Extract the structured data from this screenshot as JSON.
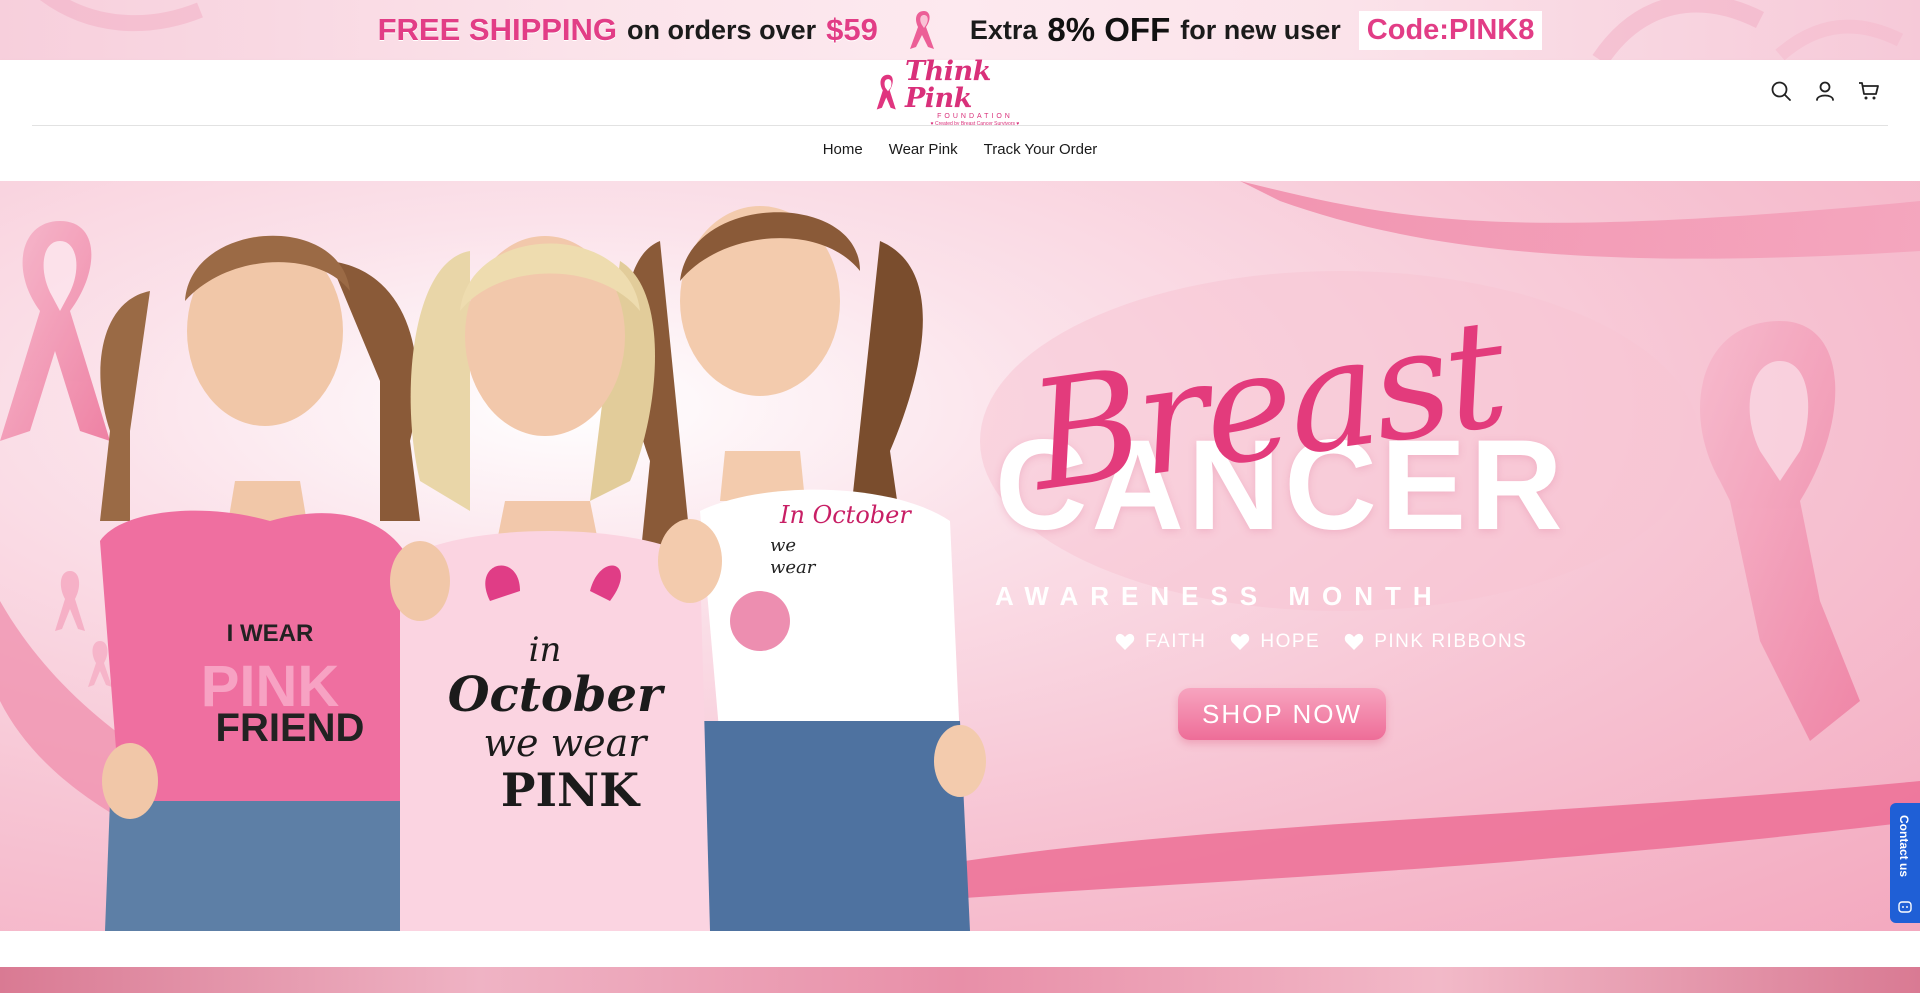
{
  "promo": {
    "free_shipping": "FREE SHIPPING",
    "on_orders_over": "on orders over",
    "threshold": "$59",
    "extra": "Extra",
    "discount": "8% OFF",
    "for_new_user": "for new user",
    "code": "Code:PINK8"
  },
  "header": {
    "logo_title": "Think Pink",
    "logo_sub": "FOUNDATION",
    "logo_tag": "♥ Created by Breast Cancer Survivors ♥",
    "icons": [
      "search-icon",
      "account-icon",
      "cart-icon"
    ]
  },
  "nav": {
    "items": [
      {
        "label": "Home"
      },
      {
        "label": "Wear Pink"
      },
      {
        "label": "Track Your Order"
      }
    ]
  },
  "hero": {
    "script_text": "Breast",
    "main_text": "CANCER",
    "sub_text": "AWARENESS MONTH",
    "values": [
      {
        "label": "FAITH"
      },
      {
        "label": "HOPE"
      },
      {
        "label": "PINK RIBBONS"
      }
    ],
    "cta": "SHOP NOW",
    "shirt_left": "I WEAR PINK FOR MY FRIEND",
    "shirt_center": "in October we wear PINK",
    "shirt_right": "In October we wear"
  },
  "contact": {
    "label": "Contact us",
    "icon": "chat-icon"
  },
  "colors": {
    "brand_pink": "#e23d86",
    "cta_pink": "#ee6d98",
    "contact_blue": "#1f5fd6"
  }
}
